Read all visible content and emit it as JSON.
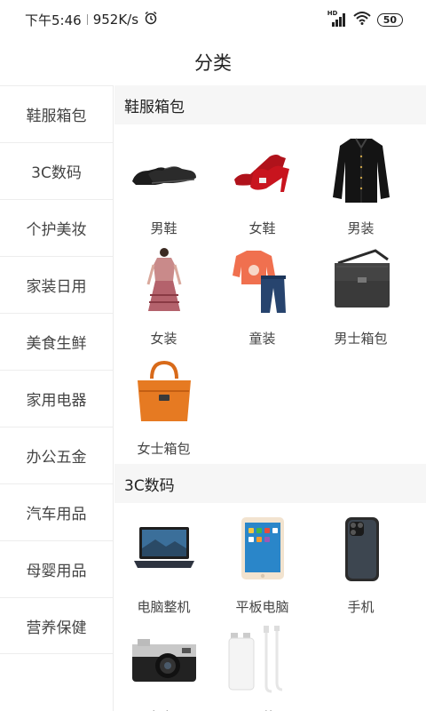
{
  "status_bar": {
    "time": "下午5:46",
    "speed": "952K/s",
    "battery": "50",
    "network_badge": "HD"
  },
  "title": "分类",
  "sidebar": {
    "items": [
      {
        "label": "鞋服箱包"
      },
      {
        "label": "3C数码"
      },
      {
        "label": "个护美妆"
      },
      {
        "label": "家装日用"
      },
      {
        "label": "美食生鲜"
      },
      {
        "label": "家用电器"
      },
      {
        "label": "办公五金"
      },
      {
        "label": "汽车用品"
      },
      {
        "label": "母婴用品"
      },
      {
        "label": "营养保健"
      }
    ]
  },
  "sections": [
    {
      "title": "鞋服箱包",
      "items": [
        {
          "label": "男鞋",
          "icon": "mens-shoes-icon"
        },
        {
          "label": "女鞋",
          "icon": "womens-shoes-icon"
        },
        {
          "label": "男装",
          "icon": "mens-clothing-icon"
        },
        {
          "label": "女装",
          "icon": "womens-clothing-icon"
        },
        {
          "label": "童装",
          "icon": "kids-clothing-icon"
        },
        {
          "label": "男士箱包",
          "icon": "mens-bag-icon"
        },
        {
          "label": "女士箱包",
          "icon": "womens-bag-icon"
        }
      ]
    },
    {
      "title": "3C数码",
      "items": [
        {
          "label": "电脑整机",
          "icon": "laptop-icon"
        },
        {
          "label": "平板电脑",
          "icon": "tablet-icon"
        },
        {
          "label": "手机",
          "icon": "phone-icon"
        },
        {
          "label": "相机",
          "icon": "camera-icon"
        },
        {
          "label": "配件",
          "icon": "charger-icon"
        }
      ]
    }
  ],
  "colors": {
    "content_bg": "#f6f6f6",
    "divider": "#ededed"
  }
}
